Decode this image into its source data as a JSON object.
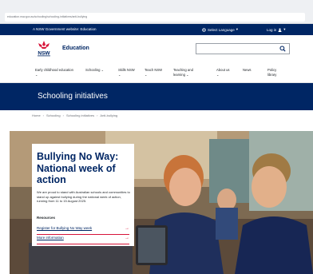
{
  "browser": {
    "url": "education.nsw.gov.au/schooling/schooling-initiatives/anti-bullying"
  },
  "gov_strip": {
    "text": "A NSW Government website: Education",
    "language_label": "Select Language",
    "login_label": "Log in"
  },
  "header": {
    "brand": "NSW",
    "site_name": "Education",
    "search_placeholder": ""
  },
  "nav": {
    "items": [
      {
        "label": "Early childhood education",
        "has_chevron": true
      },
      {
        "label": "Schooling",
        "has_chevron": true
      },
      {
        "label": "Skills NSW",
        "has_chevron": true
      },
      {
        "label": "Teach NSW",
        "has_chevron": true
      },
      {
        "label": "Teaching and learning",
        "has_chevron": true
      },
      {
        "label": "About us",
        "has_chevron": true
      },
      {
        "label": "News",
        "has_chevron": false
      },
      {
        "label": "Policy library",
        "has_chevron": false
      }
    ]
  },
  "banner": {
    "title": "Schooling initiatives"
  },
  "breadcrumbs": [
    "Home",
    "Schooling",
    "Schooling initiatives",
    "Anti-bullying"
  ],
  "card": {
    "title": "Bullying No Way: National week of action",
    "text": "We are proud to stand with Australian schools and communities to stand up against bullying during the national week of action, running from 11 to 15 August 2025.",
    "resources_heading": "Resources",
    "links": [
      {
        "label": "Register for Bullying No Way week",
        "arrow": "→"
      },
      {
        "label": "More information",
        "arrow": "→"
      }
    ]
  },
  "colors": {
    "navy": "#002664",
    "accent_red": "#d7153a",
    "white": "#ffffff"
  }
}
